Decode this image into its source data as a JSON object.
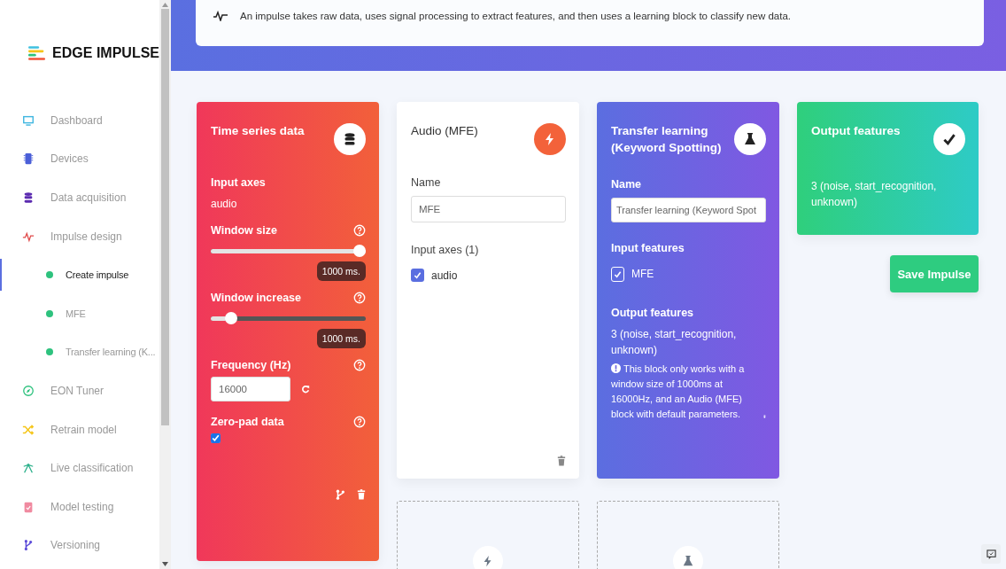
{
  "sidebar": {
    "logo": "EDGE IMPULSE",
    "items": [
      {
        "label": "Dashboard",
        "selected": false
      },
      {
        "label": "Devices",
        "selected": false
      },
      {
        "label": "Data acquisition",
        "selected": false
      },
      {
        "label": "Impulse design",
        "selected": false,
        "children": [
          {
            "label": "Create impulse",
            "selected": true
          },
          {
            "label": "MFE",
            "selected": false
          },
          {
            "label": "Transfer learning (K...",
            "selected": false
          }
        ]
      },
      {
        "label": "EON Tuner",
        "selected": false
      },
      {
        "label": "Retrain model",
        "selected": false
      },
      {
        "label": "Live classification",
        "selected": false
      },
      {
        "label": "Model testing",
        "selected": false
      },
      {
        "label": "Versioning",
        "selected": false
      }
    ]
  },
  "banner": {
    "text": "An impulse takes raw data, uses signal processing to extract features, and then uses a learning block to classify new data."
  },
  "blocks": [
    {
      "kind": "input",
      "title": "Time series data",
      "axes_label": "Input axes",
      "axes_value": "audio",
      "window_size": {
        "label": "Window size",
        "level": 1,
        "reading": "1000 ms."
      },
      "window_increase": {
        "label": "Window increase",
        "level": 0.1,
        "reading": "1000 ms."
      },
      "frequency": {
        "label": "Frequency (Hz)",
        "value": "16000"
      },
      "zero_pad": {
        "label": "Zero-pad data",
        "checked": true
      }
    },
    {
      "kind": "processing",
      "title": "Audio (MFE)",
      "name_label": "Name",
      "name_value": "MFE",
      "axes_label": "Input axes (1)",
      "axes": [
        {
          "label": "audio",
          "checked": true
        }
      ]
    },
    {
      "kind": "learning",
      "title": "Transfer learning (Keyword Spotting)",
      "name_label": "Name",
      "name_value": "Transfer learning (Keyword Spot",
      "input_label": "Input features",
      "inputs": [
        {
          "label": "MFE",
          "checked": true
        }
      ],
      "output_label": "Output features",
      "output_value": "3 (noise, start_recognition, unknown)",
      "note": "This block only works with a window size of 1000ms at 16000Hz, and an Audio (MFE) block with default parameters."
    },
    {
      "kind": "output",
      "title": "Output features",
      "value": "3 (noise, start_recognition, unknown)",
      "button": "Save Impulse"
    }
  ]
}
